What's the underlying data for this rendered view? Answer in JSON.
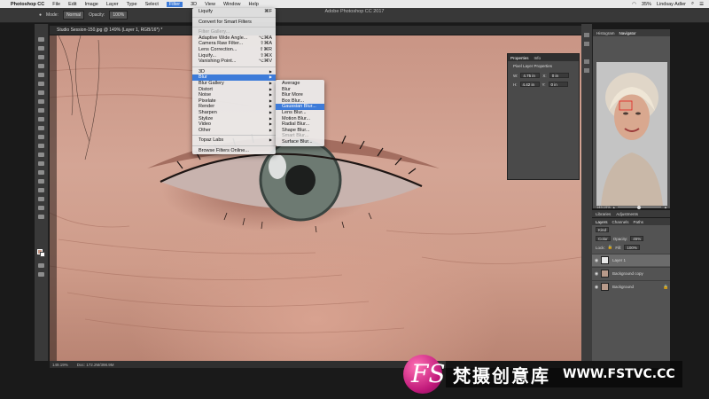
{
  "menubar": {
    "app": "Photoshop CC",
    "items": [
      "File",
      "Edit",
      "Image",
      "Layer",
      "Type",
      "Select",
      "Filter",
      "3D",
      "View",
      "Window",
      "Help"
    ],
    "active_item": "Filter",
    "battery": "35%",
    "user": "Lindsay Adler"
  },
  "app_title": "Adobe Photoshop CC 2017",
  "optbar": {
    "mode_label": "Mode:",
    "mode_value": "Normal",
    "opacity_label": "Opacity:",
    "opacity_value": "100%"
  },
  "document_tab": "Studio Session-150.jpg @ 149% (Layer 1, RGB/16*) *",
  "filter_menu": {
    "top": [
      {
        "label": "Liquify",
        "shortcut": "⌘F"
      },
      {
        "label": "Convert for Smart Filters",
        "shortcut": ""
      }
    ],
    "gallery": [
      {
        "label": "Filter Gallery...",
        "shortcut": "",
        "disabled": true
      },
      {
        "label": "Adaptive Wide Angle...",
        "shortcut": "⌥⌘A"
      },
      {
        "label": "Camera Raw Filter...",
        "shortcut": "⇧⌘A"
      },
      {
        "label": "Lens Correction...",
        "shortcut": "⇧⌘R"
      },
      {
        "label": "Liquify...",
        "shortcut": "⇧⌘X"
      },
      {
        "label": "Vanishing Point...",
        "shortcut": "⌥⌘V"
      }
    ],
    "categories": [
      "3D",
      "Blur",
      "Blur Gallery",
      "Distort",
      "Noise",
      "Pixelate",
      "Render",
      "Sharpen",
      "Stylize",
      "Video",
      "Other"
    ],
    "highlighted": "Blur",
    "plugins": [
      "Topaz Labs"
    ],
    "browse": "Browse Filters Online..."
  },
  "blur_menu": {
    "items": [
      "Average",
      "Blur",
      "Blur More",
      "Box Blur...",
      "Gaussian Blur...",
      "Lens Blur...",
      "Motion Blur...",
      "Radial Blur...",
      "Shape Blur...",
      "Smart Blur...",
      "Surface Blur..."
    ],
    "highlighted": "Gaussian Blur...",
    "disabled": [
      "Smart Blur..."
    ]
  },
  "properties": {
    "tabs": [
      "Properties",
      "Info"
    ],
    "header": "Pixel Layer Properties",
    "w_label": "W:",
    "w_value": "4.75 in",
    "h_label": "H:",
    "h_value": "4.42 in",
    "x_label": "X:",
    "x_value": "0 in",
    "y_label": "Y:",
    "y_value": "0 in"
  },
  "navigator": {
    "tabs": [
      "Histogram",
      "Navigator"
    ],
    "zoom": "149.19%"
  },
  "libraries_tabs": [
    "Libraries",
    "Adjustments"
  ],
  "layers": {
    "tabs": [
      "Layers",
      "Channels",
      "Paths"
    ],
    "kind_label": "Kind",
    "blend": "Color",
    "opacity_label": "Opacity:",
    "opacity_value": "45%",
    "lock_label": "Lock:",
    "fill_label": "Fill:",
    "fill_value": "100%",
    "items": [
      {
        "name": "Layer 1",
        "selected": true
      },
      {
        "name": "Background copy",
        "selected": false
      },
      {
        "name": "Background",
        "selected": false
      }
    ]
  },
  "status": {
    "zoom": "149.19%",
    "doc": "Doc: 172.2M/398.9M"
  },
  "watermark": {
    "logo": "FS",
    "chinese": "梵摄创意库",
    "url": "WWW.FSTVC.CC"
  },
  "colors": {
    "highlight": "#3d7bd9",
    "skin": "#d4a595",
    "panel": "#535353"
  }
}
